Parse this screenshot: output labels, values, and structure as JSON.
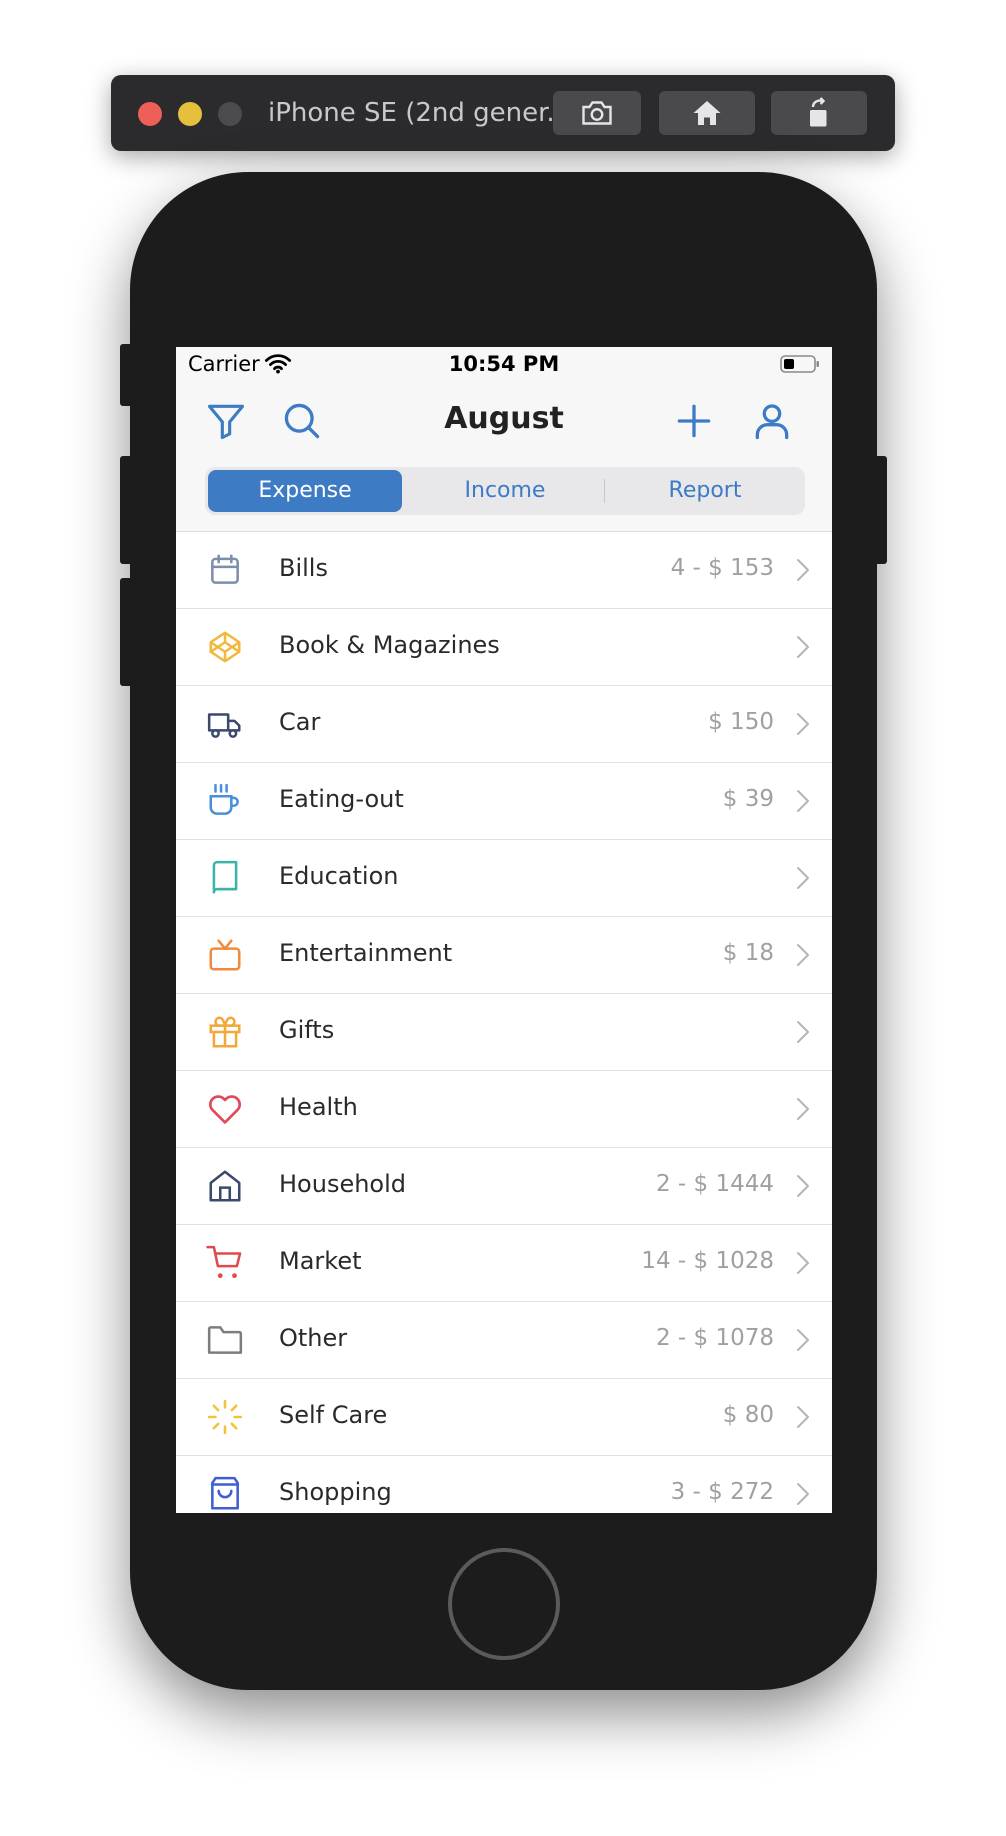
{
  "simulator": {
    "title": "iPhone SE (2nd gener...",
    "buttons": [
      "screenshot-icon",
      "home-icon",
      "rotate-icon"
    ]
  },
  "status_bar": {
    "carrier": "Carrier",
    "time": "10:54 PM"
  },
  "nav": {
    "title": "August",
    "icons": [
      "filter-icon",
      "search-icon",
      "plus-icon",
      "user-icon"
    ]
  },
  "segments": {
    "expense": "Expense",
    "income": "Income",
    "report": "Report",
    "active": "Expense"
  },
  "colors": {
    "accent": "#3d7bc4"
  },
  "categories": [
    {
      "label": "Bills",
      "value": "4 - $ 153",
      "icon": "calendar-icon",
      "color": "#7c8ea8"
    },
    {
      "label": "Book & Magazines",
      "value": "",
      "icon": "codepen-icon",
      "color": "#f2b83a"
    },
    {
      "label": "Car",
      "value": "$ 150",
      "icon": "truck-icon",
      "color": "#3b4a6b"
    },
    {
      "label": "Eating-out",
      "value": "$ 39",
      "icon": "coffee-icon",
      "color": "#4a90d9"
    },
    {
      "label": "Education",
      "value": "",
      "icon": "book-icon",
      "color": "#3bb3a8"
    },
    {
      "label": "Entertainment",
      "value": "$ 18",
      "icon": "tv-icon",
      "color": "#f08a3c"
    },
    {
      "label": "Gifts",
      "value": "",
      "icon": "gift-icon",
      "color": "#f2a93a"
    },
    {
      "label": "Health",
      "value": "",
      "icon": "heart-icon",
      "color": "#e04a5a"
    },
    {
      "label": "Household",
      "value": "2 - $ 1444",
      "icon": "home-icon",
      "color": "#3b4a6b"
    },
    {
      "label": "Market",
      "value": "14 - $ 1028",
      "icon": "shopping-cart-icon",
      "color": "#e04a4a"
    },
    {
      "label": "Other",
      "value": "2 - $ 1078",
      "icon": "folder-icon",
      "color": "#7d7d7d"
    },
    {
      "label": "Self Care",
      "value": "$ 80",
      "icon": "loader-icon",
      "color": "#f2c23a"
    },
    {
      "label": "Shopping",
      "value": "3 - $ 272",
      "icon": "shopping-bag-icon",
      "color": "#3d5fd4"
    }
  ]
}
